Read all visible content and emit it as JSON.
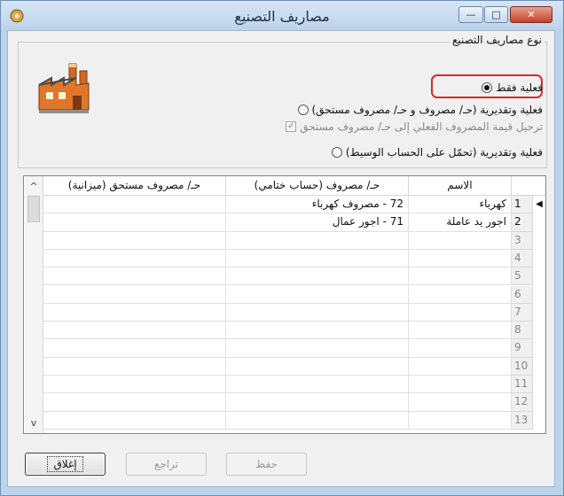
{
  "window": {
    "title": "مصاريف التصنيع",
    "controls": {
      "minimize": "—",
      "maximize": "□",
      "close": "✕"
    }
  },
  "options": {
    "group_label": "نوع مصاريف التصنيع",
    "actual_only": "فعلية فقط",
    "actual_estimated": "فعلية وتقديرية (حـ/ مصروف و حـ/ مصروف مستحق)",
    "transfer_check": "ترحيل قيمة المصروف الفعلي إلى حـ/ مصروف مستحق",
    "actual_intermediate": "فعلية وتقديرية (تحمّل على الحساب الوسيط)",
    "selected": "actual_only"
  },
  "grid": {
    "columns": [
      "الاسم",
      "حـ/ مصروف (حساب ختامي)",
      "حـ/ مصروف مستحق (ميزانية)"
    ],
    "rows": [
      {
        "num": "1",
        "name": "كهرباء",
        "expense": "72 - مصروف كهرباء",
        "accrued": ""
      },
      {
        "num": "2",
        "name": "اجور يد عاملة",
        "expense": "71 - اجور عمال",
        "accrued": ""
      },
      {
        "num": "3",
        "name": "",
        "expense": "",
        "accrued": ""
      },
      {
        "num": "4",
        "name": "",
        "expense": "",
        "accrued": ""
      },
      {
        "num": "5",
        "name": "",
        "expense": "",
        "accrued": ""
      },
      {
        "num": "6",
        "name": "",
        "expense": "",
        "accrued": ""
      },
      {
        "num": "7",
        "name": "",
        "expense": "",
        "accrued": ""
      },
      {
        "num": "8",
        "name": "",
        "expense": "",
        "accrued": ""
      },
      {
        "num": "9",
        "name": "",
        "expense": "",
        "accrued": ""
      },
      {
        "num": "10",
        "name": "",
        "expense": "",
        "accrued": ""
      },
      {
        "num": "11",
        "name": "",
        "expense": "",
        "accrued": ""
      },
      {
        "num": "12",
        "name": "",
        "expense": "",
        "accrued": ""
      },
      {
        "num": "13",
        "name": "",
        "expense": "",
        "accrued": ""
      }
    ],
    "current_row_marker": "◀",
    "scroll_up": "^",
    "scroll_down": "v"
  },
  "buttons": {
    "save": "حفظ",
    "undo": "تراجع",
    "close": "إغلاق"
  },
  "colors": {
    "highlight": "#d62a2a",
    "title_bar": "#bcd2ea",
    "close_button": "#c4422a"
  },
  "icons": {
    "app": "app-logo-icon",
    "factory": "factory-icon"
  }
}
